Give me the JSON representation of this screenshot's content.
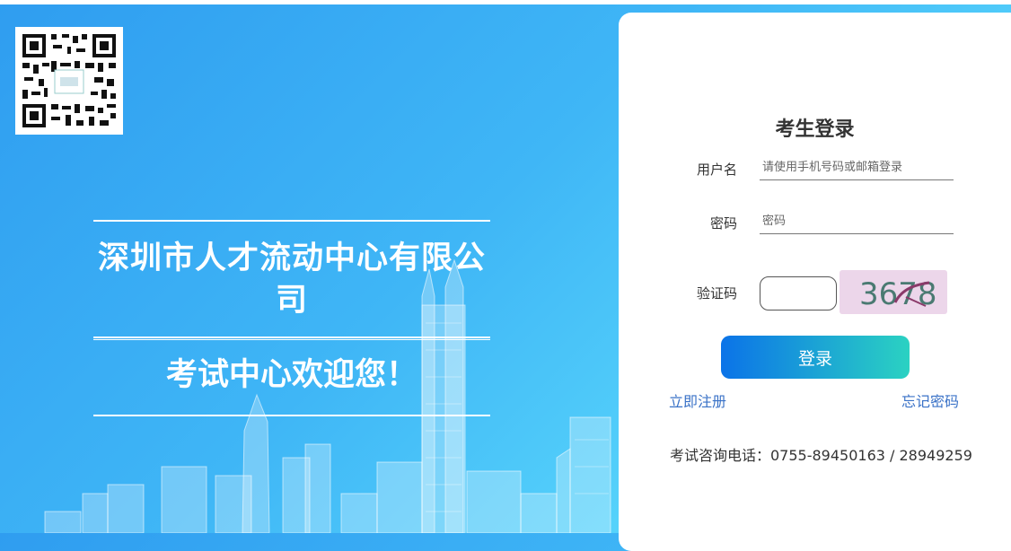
{
  "welcome": {
    "company": "深圳市人才流动中心有限公司",
    "subtitle": "考试中心欢迎您！"
  },
  "qr_code": {
    "label": "二维码"
  },
  "login": {
    "title": "考生登录",
    "username_label": "用户名",
    "username_placeholder": "请使用手机号码或邮箱登录",
    "password_label": "密码",
    "password_placeholder": "密码",
    "captcha_label": "验证码",
    "captcha_text": "3678",
    "submit_label": "登录",
    "register_link": "立即注册",
    "forgot_link": "忘记密码",
    "phone_text": "考试咨询电话：0755-89450163 / 28949259"
  },
  "colors": {
    "bg_start": "#2f9df0",
    "bg_end": "#62e1fb",
    "button_start": "#0b73e8",
    "button_end": "#2bd2c2",
    "link": "#3a72c7"
  }
}
